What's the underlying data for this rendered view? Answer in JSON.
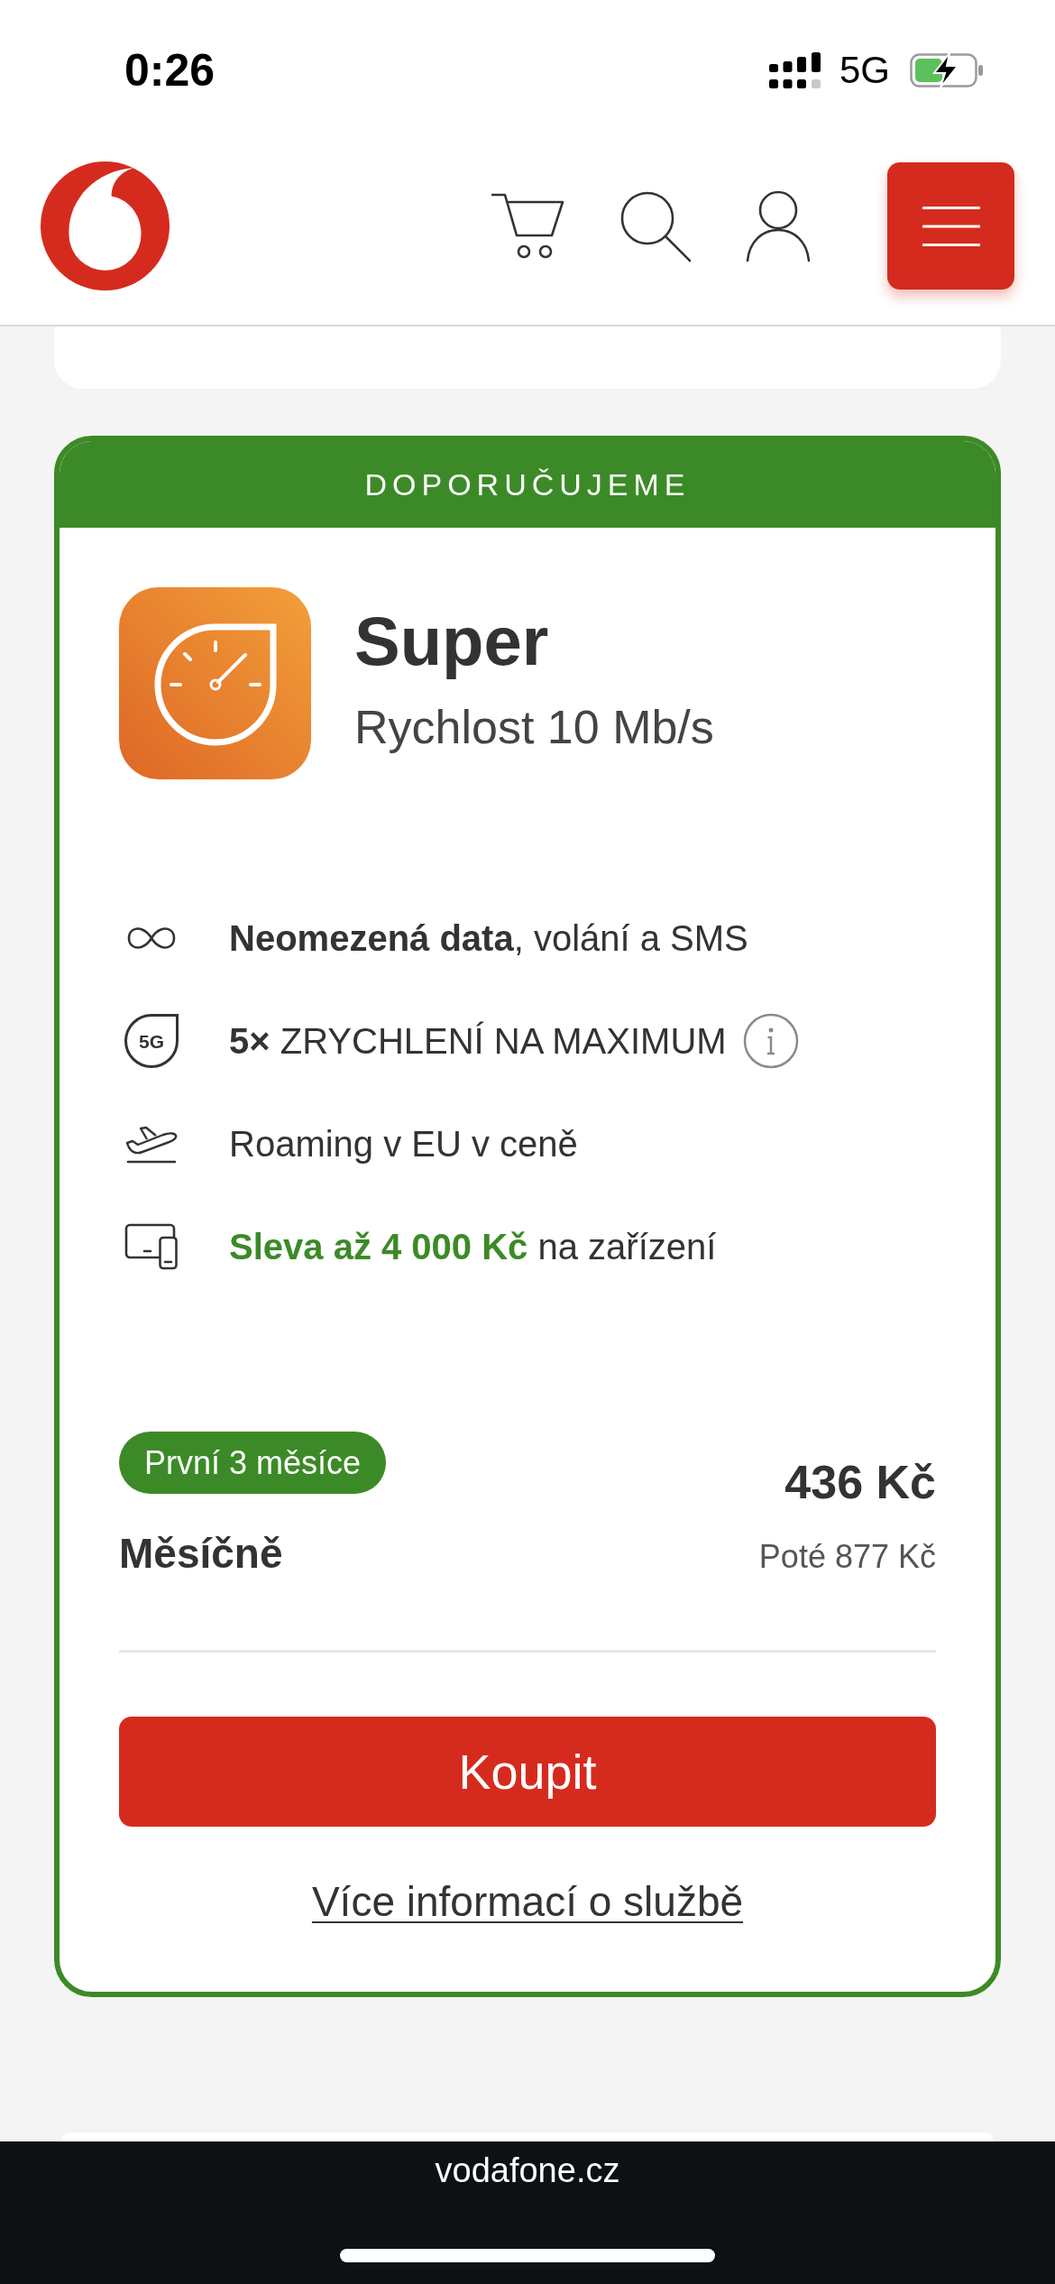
{
  "status_bar": {
    "time": "0:26",
    "network": "5G"
  },
  "plan_card": {
    "banner": "DOPORUČUJEME",
    "name": "Super",
    "speed": "Rychlost 10 Mb/s",
    "features": [
      {
        "kind": "infinity",
        "text": "**Neomezená data**, volání a SMS",
        "highlighted": false,
        "info": false
      },
      {
        "kind": "badge",
        "icon_text": "5G",
        "text": "**5×** ZRYCHLENÍ NA MAXIMUM",
        "highlighted": false,
        "info": true
      },
      {
        "kind": "plane",
        "text": "Roaming v EU v ceně",
        "highlighted": false,
        "info": false
      },
      {
        "kind": "devices",
        "text": "**Sleva až 4 000 Kč** na zařízení",
        "highlighted": true,
        "info": false
      }
    ],
    "price": {
      "badge": "První 3 měsíce",
      "label": "Měsíčně",
      "amount": "436 Kč",
      "after": "Poté 877 Kč"
    },
    "buy_button": "Koupit",
    "more_link": "Více informací o službě"
  },
  "browser_bar": {
    "url": "vodafone.cz"
  }
}
